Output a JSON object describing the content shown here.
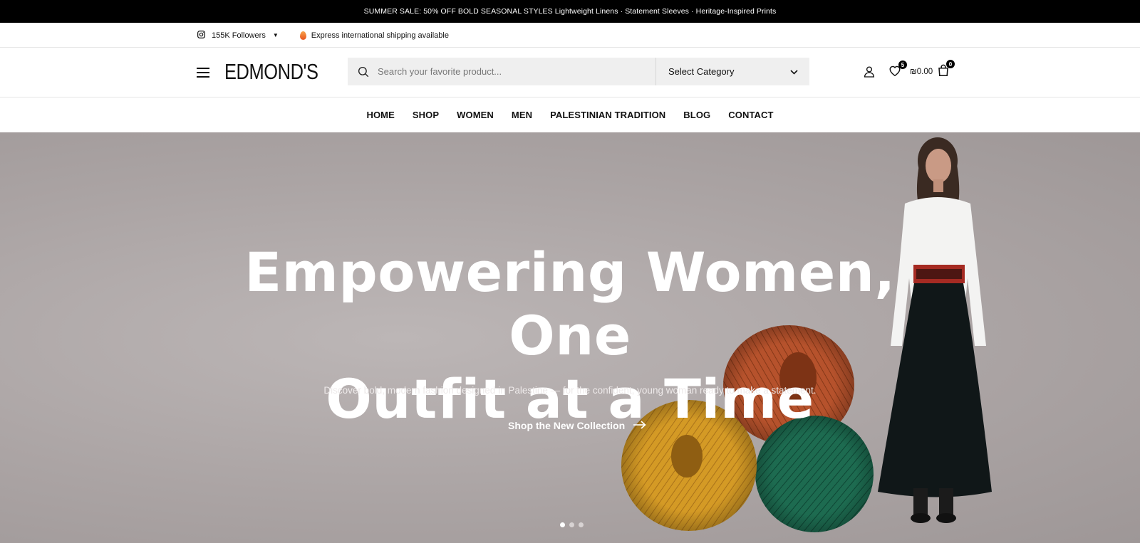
{
  "announcement": {
    "text": "SUMMER SALE: 50% OFF BOLD SEASONAL STYLES Lightweight Linens · Statement Sleeves · Heritage-Inspired Prints"
  },
  "topbar": {
    "social_icon": "instagram-icon",
    "followers": "155K Followers",
    "shipping_icon": "flame-icon",
    "shipping": "Express international shipping available"
  },
  "header": {
    "logo": "EDMOND'S",
    "search": {
      "placeholder": "Search your favorite product...",
      "value": ""
    },
    "category_select": "Select Category",
    "wishlist_count": "5",
    "cart_total": "₪0.00",
    "cart_count": "0"
  },
  "nav": {
    "items": [
      "HOME",
      "SHOP",
      "WOMEN",
      "MEN",
      "PALESTINIAN TRADITION",
      "BLOG",
      "CONTACT"
    ]
  },
  "hero": {
    "headline_line1": "Empowering Women, One",
    "headline_line2": "Outfit at a Time",
    "subtitle": "Discover bold, modern fashion designed in Palestine — for the confident, young woman ready to make a statement.",
    "cta": "Shop the New Collection",
    "slides": 3,
    "active_slide": 1
  },
  "colors": {
    "announcement_bg": "#000000",
    "hero_bg": "#aba4a4",
    "yarn_yellow": "#d9a02a",
    "yarn_orange": "#b8552e",
    "yarn_green": "#1c6a4f"
  }
}
